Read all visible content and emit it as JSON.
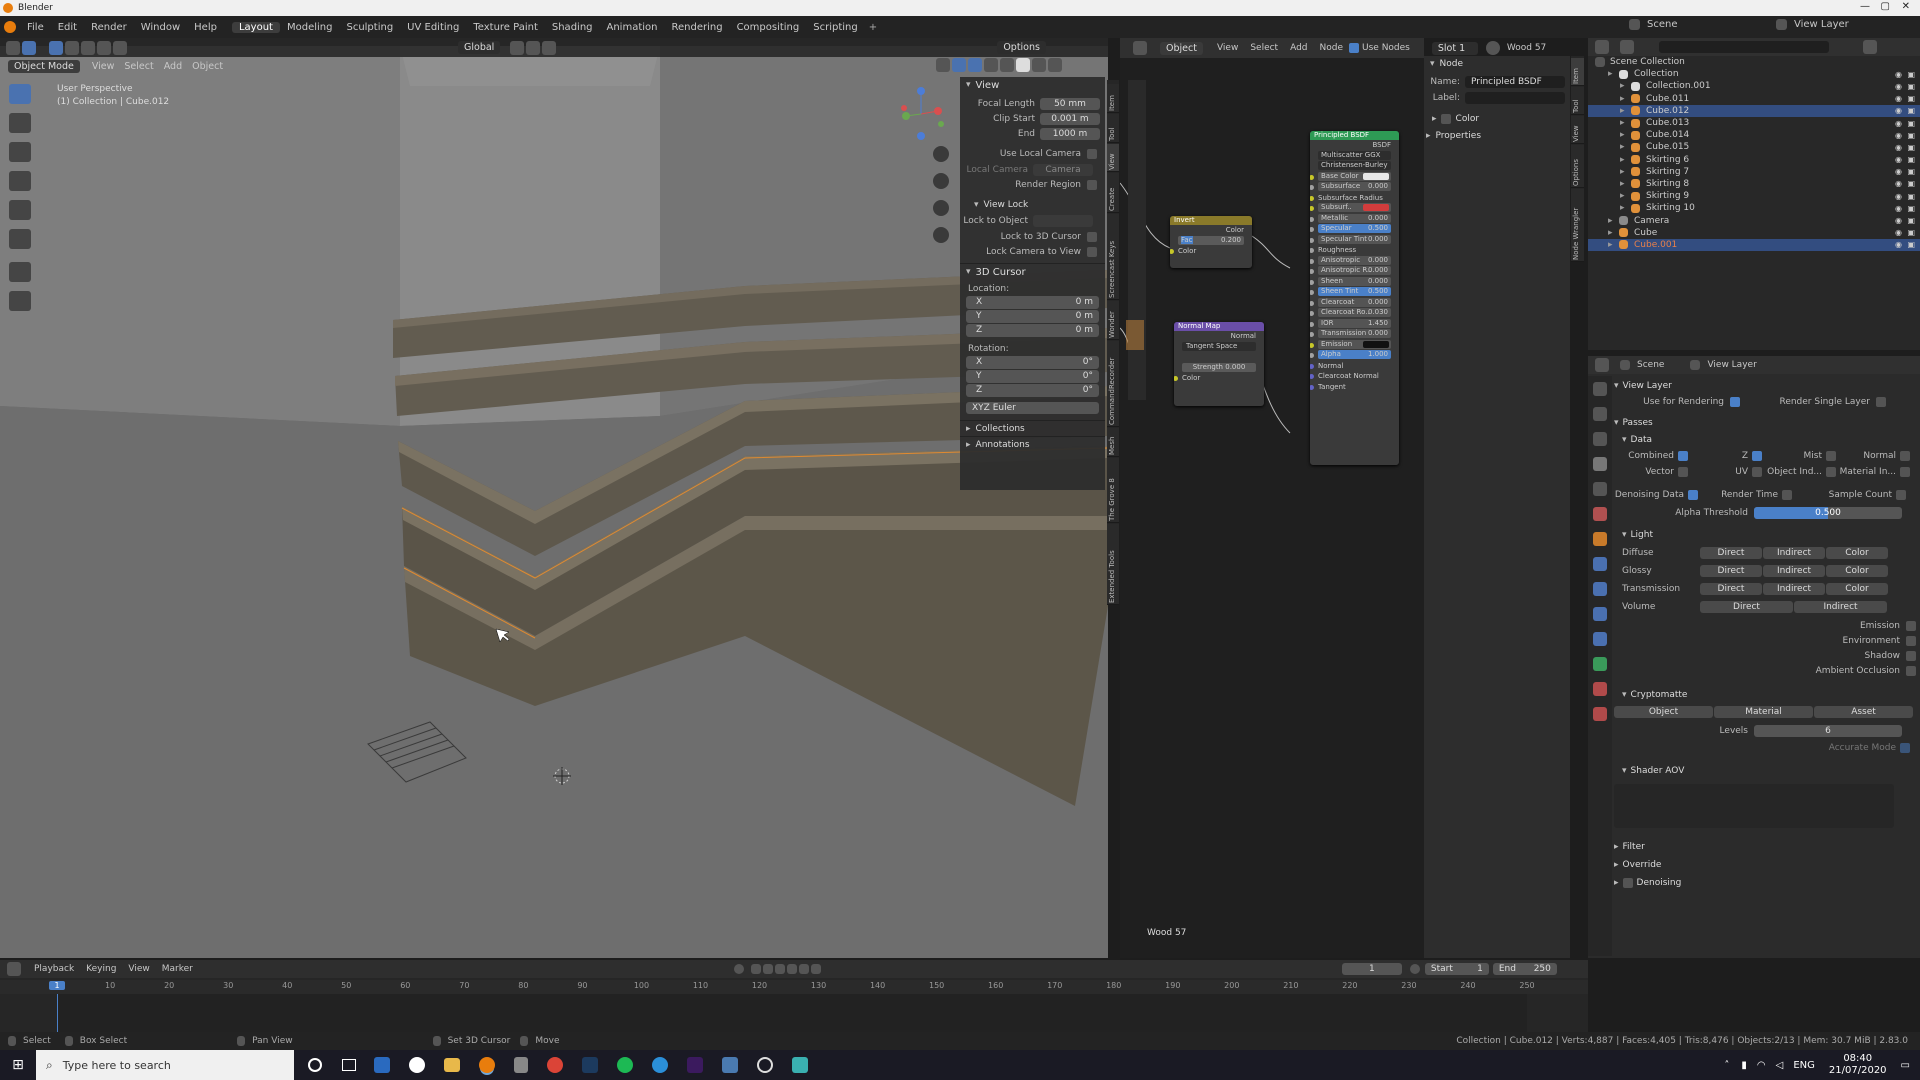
{
  "app": {
    "title": "Blender"
  },
  "menu": [
    "File",
    "Edit",
    "Render",
    "Window",
    "Help"
  ],
  "workspaces": [
    "Layout",
    "Modeling",
    "Sculpting",
    "UV Editing",
    "Texture Paint",
    "Shading",
    "Animation",
    "Rendering",
    "Compositing",
    "Scripting"
  ],
  "active_workspace": "Layout",
  "top_right": {
    "scene": "Scene",
    "view_layer": "View Layer"
  },
  "viewport": {
    "mode": "Object Mode",
    "menus": [
      "View",
      "Select",
      "Add",
      "Object"
    ],
    "orientation": "Global",
    "options": "Options",
    "overlay_title": "User Perspective",
    "overlay_sub": "(1) Collection | Cube.012"
  },
  "npanel": {
    "view_title": "View",
    "focal_label": "Focal Length",
    "focal": "50 mm",
    "clip_start_label": "Clip Start",
    "clip_start": "0.001 m",
    "end_label": "End",
    "clip_end": "1000 m",
    "use_local_camera": "Use Local Camera",
    "local_camera": "Local Camera",
    "camera": "Camera",
    "render_region": "Render Region",
    "view_lock": "View Lock",
    "lock_to_object": "Lock to Object",
    "lock_3d_cursor": "Lock to 3D Cursor",
    "lock_camera": "Lock Camera to View",
    "cursor_title": "3D Cursor",
    "location": "Location:",
    "rotation": "Rotation:",
    "loc": [
      {
        "axis": "X",
        "v": "0 m"
      },
      {
        "axis": "Y",
        "v": "0 m"
      },
      {
        "axis": "Z",
        "v": "0 m"
      }
    ],
    "rot": [
      {
        "axis": "X",
        "v": "0°"
      },
      {
        "axis": "Y",
        "v": "0°"
      },
      {
        "axis": "Z",
        "v": "0°"
      }
    ],
    "euler": "XYZ Euler",
    "collections": "Collections",
    "annotations": "Annotations",
    "tabs": [
      "Item",
      "Tool",
      "View",
      "Create",
      "Screencast Keys",
      "Wonder",
      "CommandRecorder",
      "Mesh",
      "The Grove 8",
      "Extended Tools"
    ]
  },
  "node_editor": {
    "object": "Object",
    "menus": [
      "View",
      "Select",
      "Add",
      "Node"
    ],
    "use_nodes": "Use Nodes",
    "slot": "Slot 1",
    "material": "Wood 57",
    "footer": "Wood 57",
    "sidebar": {
      "section": "Node",
      "name_label": "Name:",
      "name": "Principled BSDF",
      "label_label": "Label:",
      "color": "Color",
      "properties": "Properties"
    },
    "side_tabs": [
      "Item",
      "Tool",
      "View",
      "Options",
      "Node Wrangler"
    ],
    "invert": {
      "title": "Invert",
      "out": "Color",
      "fac": "Fac",
      "fac_v": "0.200",
      "color": "Color"
    },
    "normal_map": {
      "title": "Normal Map",
      "out": "Normal",
      "space": "Tangent Space",
      "strength": "Strength",
      "strength_v": "0.000",
      "color": "Color"
    },
    "principled": {
      "title": "Principled BSDF",
      "out": "BSDF",
      "dist": "Multiscatter GGX",
      "sss": "Christensen-Burley",
      "inputs": [
        {
          "n": "Base Color",
          "v": "",
          "t": "white"
        },
        {
          "n": "Subsurface",
          "v": "0.000"
        },
        {
          "n": "Subsurface Radius",
          "v": ""
        },
        {
          "n": "Subsurf..",
          "v": "",
          "t": "red"
        },
        {
          "n": "Metallic",
          "v": "0.000"
        },
        {
          "n": "Specular",
          "v": "0.500",
          "t": "blue"
        },
        {
          "n": "Specular Tint",
          "v": "0.000"
        },
        {
          "n": "Roughness",
          "v": ""
        },
        {
          "n": "Anisotropic",
          "v": "0.000"
        },
        {
          "n": "Anisotropic R..",
          "v": "0.000"
        },
        {
          "n": "Sheen",
          "v": "0.000"
        },
        {
          "n": "Sheen Tint",
          "v": "0.500",
          "t": "blue"
        },
        {
          "n": "Clearcoat",
          "v": "0.000"
        },
        {
          "n": "Clearcoat Ro..",
          "v": "0.030"
        },
        {
          "n": "IOR",
          "v": "1.450"
        },
        {
          "n": "Transmission",
          "v": "0.000"
        },
        {
          "n": "Emission",
          "v": "",
          "t": "black"
        },
        {
          "n": "Alpha",
          "v": "1.000",
          "t": "blue"
        },
        {
          "n": "Normal",
          "v": ""
        },
        {
          "n": "Clearcoat Normal",
          "v": ""
        },
        {
          "n": "Tangent",
          "v": ""
        }
      ]
    }
  },
  "outliner": {
    "root": "Scene Collection",
    "items": [
      {
        "n": "Collection",
        "d": 1,
        "sel": false
      },
      {
        "n": "Collection.001",
        "d": 2,
        "sel": false
      },
      {
        "n": "Cube.011",
        "d": 2,
        "sel": false
      },
      {
        "n": "Cube.012",
        "d": 2,
        "sel": true
      },
      {
        "n": "Cube.013",
        "d": 2,
        "sel": false
      },
      {
        "n": "Cube.014",
        "d": 2,
        "sel": false
      },
      {
        "n": "Cube.015",
        "d": 2,
        "sel": false
      },
      {
        "n": "Skirting 6",
        "d": 2,
        "sel": false
      },
      {
        "n": "Skirting 7",
        "d": 2,
        "sel": false
      },
      {
        "n": "Skirting 8",
        "d": 2,
        "sel": false
      },
      {
        "n": "Skirting 9",
        "d": 2,
        "sel": false
      },
      {
        "n": "Skirting 10",
        "d": 2,
        "sel": false
      },
      {
        "n": "Camera",
        "d": 1,
        "sel": false
      },
      {
        "n": "Cube",
        "d": 1,
        "sel": false
      },
      {
        "n": "Cube.001",
        "d": 1,
        "sel": true,
        "active": true
      }
    ]
  },
  "props": {
    "scene": "Scene",
    "view_layer": "View Layer",
    "vl_title": "View Layer",
    "use_for_rendering": "Use for Rendering",
    "render_single": "Render Single Layer",
    "passes": "Passes",
    "data": "Data",
    "combined": "Combined",
    "z": "Z",
    "mist": "Mist",
    "normal": "Normal",
    "vector": "Vector",
    "uv": "UV",
    "object_ind": "Object Ind...",
    "material_in": "Material In...",
    "denoising_data": "Denoising Data",
    "render_time": "Render Time",
    "sample_count": "Sample Count",
    "alpha_threshold": "Alpha Threshold",
    "alpha_v": "0.500",
    "light": "Light",
    "light_rows": [
      {
        "n": "Diffuse",
        "b": [
          "Direct",
          "Indirect",
          "Color"
        ]
      },
      {
        "n": "Glossy",
        "b": [
          "Direct",
          "Indirect",
          "Color"
        ]
      },
      {
        "n": "Transmission",
        "b": [
          "Direct",
          "Indirect",
          "Color"
        ]
      },
      {
        "n": "Volume",
        "b": [
          "Direct",
          "Indirect"
        ]
      }
    ],
    "light_checks": [
      "Emission",
      "Environment",
      "Shadow",
      "Ambient Occlusion"
    ],
    "crypto": "Cryptomatte",
    "crypto_btns": [
      "Object",
      "Material",
      "Asset"
    ],
    "levels": "Levels",
    "levels_v": "6",
    "accurate": "Accurate Mode",
    "shader_aov": "Shader AOV",
    "filter": "Filter",
    "override": "Override",
    "denoising": "Denoising"
  },
  "timeline": {
    "menus": [
      "Playback",
      "Keying",
      "View",
      "Marker"
    ],
    "current": "1",
    "start_label": "Start",
    "start": "1",
    "end_label": "End",
    "end": "250",
    "ticks": [
      "1",
      "10",
      "20",
      "30",
      "40",
      "50",
      "60",
      "70",
      "80",
      "90",
      "100",
      "110",
      "120",
      "130",
      "140",
      "150",
      "160",
      "170",
      "180",
      "190",
      "200",
      "210",
      "220",
      "230",
      "240",
      "250"
    ]
  },
  "statusbar": {
    "select": "Select",
    "box": "Box Select",
    "pan": "Pan View",
    "cursor": "Set 3D Cursor",
    "move": "Move",
    "info": "Collection | Cube.012 | Verts:4,887 | Faces:4,405 | Tris:8,476 | Objects:2/13 | Mem: 30.7 MiB | 2.83.0"
  },
  "taskbar": {
    "search": "Type here to search",
    "lang": "ENG",
    "time": "08:40",
    "date": "21/07/2020"
  }
}
